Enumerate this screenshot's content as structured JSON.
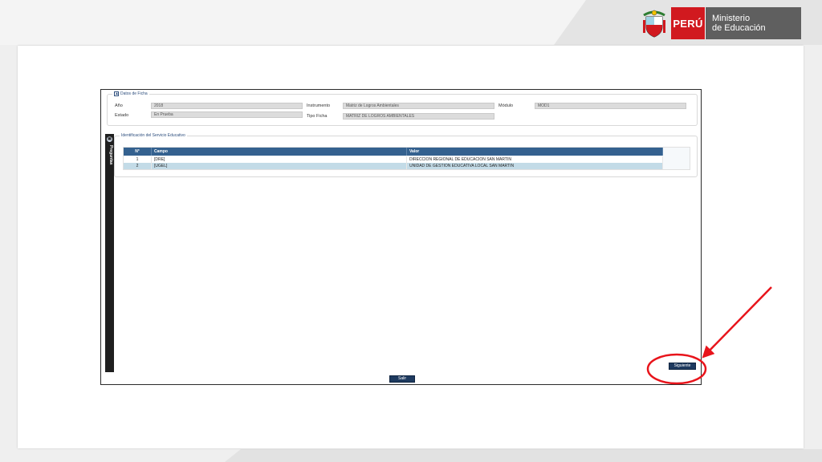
{
  "header": {
    "peru_label": "PERÚ",
    "ministry_line1": "Ministerio",
    "ministry_line2": "de Educación"
  },
  "datos_ficha": {
    "legend": "Datos de Ficha",
    "toggle": "▲",
    "fields": {
      "anio_label": "Año",
      "anio_value": "2018",
      "estado_label": "Estado",
      "estado_value": "En Prueba",
      "instrumento_label": "Instrumento",
      "instrumento_value": "Matriz de Logros Ambientales",
      "tipo_ficha_label": "Tipo Ficha",
      "tipo_ficha_value": "MATRIZ DE LOGROS AMBIENTALES",
      "modulo_label": "Módulo",
      "modulo_value": "MOD1"
    }
  },
  "side_tab": {
    "icon": "▣",
    "label": "Preguntas"
  },
  "servicio": {
    "legend": "Identificación del Servicio Educativo",
    "columns": {
      "n": "N°",
      "campo": "Campo",
      "valor": "Valor"
    },
    "rows": [
      {
        "n": "1",
        "campo": "[DRE]",
        "valor": "DIRECCION REGIONAL DE EDUCACION SAN MARTIN"
      },
      {
        "n": "2",
        "campo": "[UGEL]",
        "valor": "UNIDAD DE GESTION EDUCATIVA LOCAL SAN MARTIN"
      }
    ]
  },
  "buttons": {
    "siguiente": "Siguiente",
    "salir": "Salir"
  },
  "colors": {
    "peru_red": "#d1191f",
    "ministry_gray": "#5f5f5f",
    "grid_header": "#34618f",
    "selected_row": "#c3dbe7",
    "button_navy": "#1e3a5f",
    "annotation_red": "#e8141b"
  }
}
